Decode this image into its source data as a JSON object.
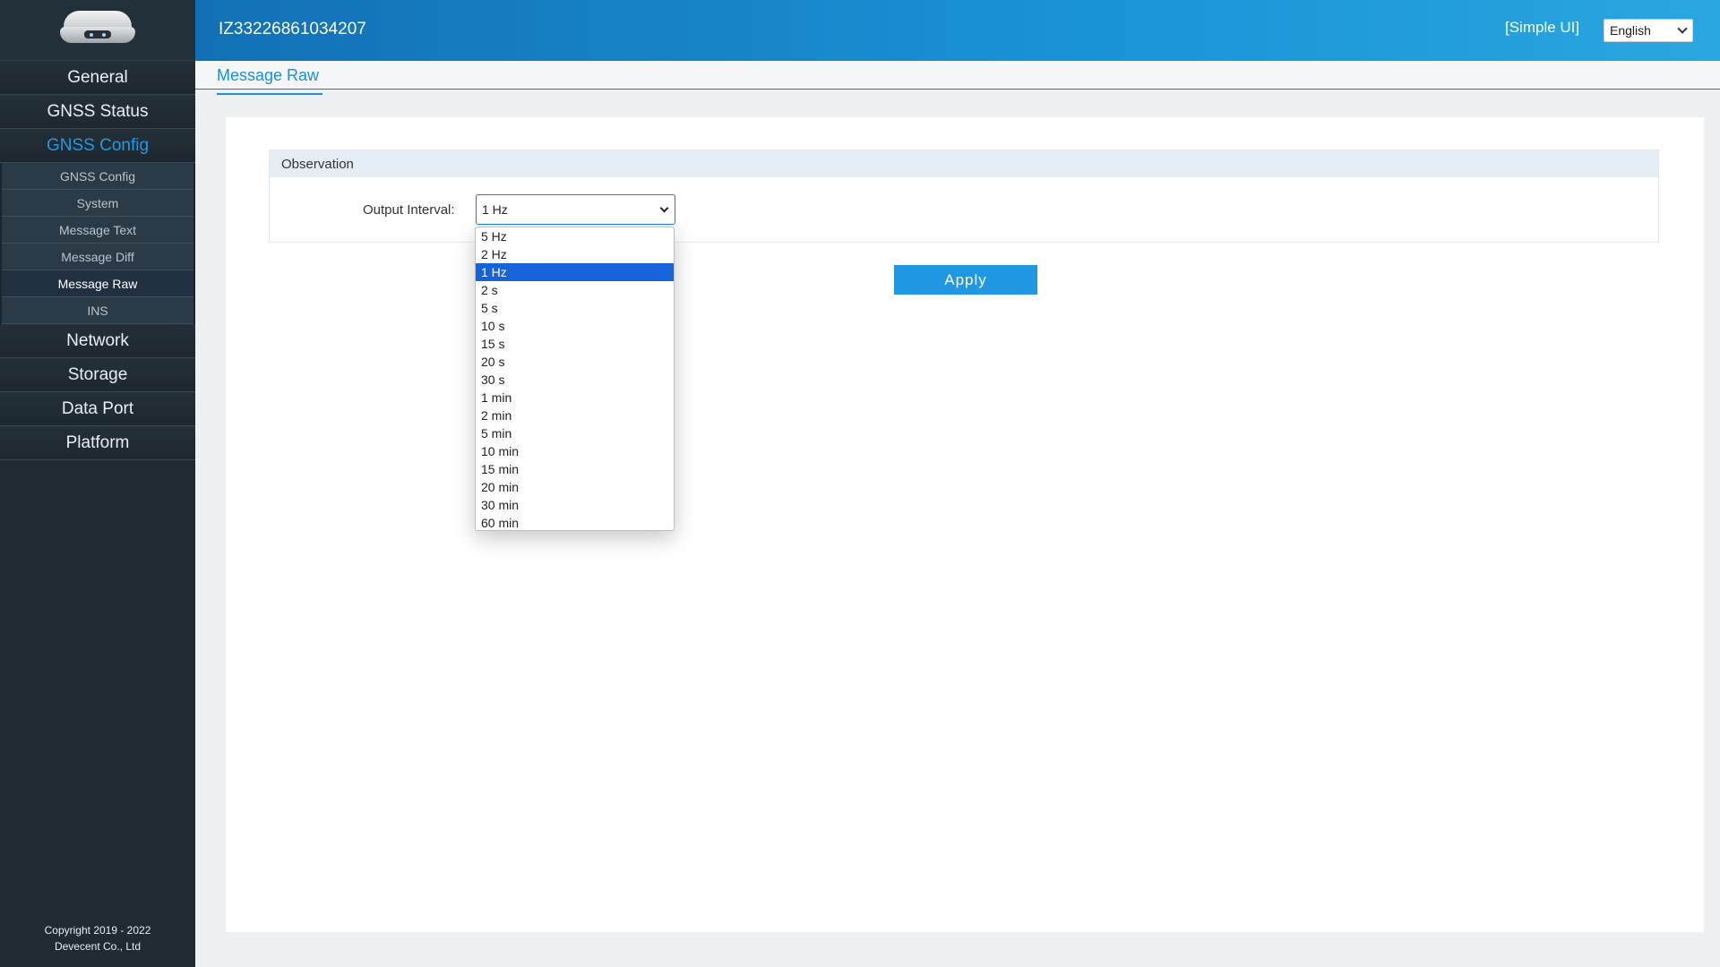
{
  "header": {
    "device_id": "IZ33226861034207",
    "simple_ui": "[Simple UI]",
    "language": "English"
  },
  "sidebar": {
    "items": [
      {
        "label": "General"
      },
      {
        "label": "GNSS Status"
      },
      {
        "label": "GNSS Config"
      }
    ],
    "sub_items": [
      {
        "label": "GNSS Config"
      },
      {
        "label": "System"
      },
      {
        "label": "Message Text"
      },
      {
        "label": "Message Diff"
      },
      {
        "label": "Message Raw"
      },
      {
        "label": "INS"
      }
    ],
    "items_after": [
      {
        "label": "Network"
      },
      {
        "label": "Storage"
      },
      {
        "label": "Data Port"
      },
      {
        "label": "Platform"
      }
    ],
    "copyright_line1": "Copyright 2019 - 2022",
    "copyright_line2": "Devecent Co., Ltd"
  },
  "page": {
    "title": "Message Raw",
    "section_title": "Observation",
    "output_interval_label": "Output Interval:",
    "output_interval_value": "1 Hz",
    "apply_label": "Apply",
    "options": [
      "5 Hz",
      "2 Hz",
      "1 Hz",
      "2 s",
      "5 s",
      "10 s",
      "15 s",
      "20 s",
      "30 s",
      "1 min",
      "2 min",
      "5 min",
      "10 min",
      "15 min",
      "20 min",
      "30 min",
      "60 min"
    ]
  }
}
